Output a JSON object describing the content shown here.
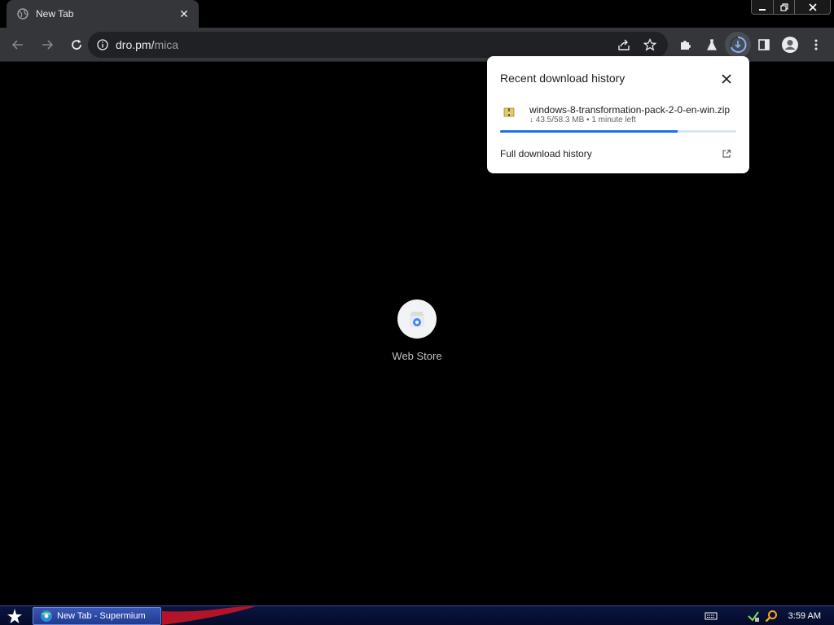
{
  "tab": {
    "title": "New Tab",
    "close_glyph": "✕"
  },
  "window_controls": {
    "minimize": "minimize-icon",
    "restore": "restore-icon",
    "close": "close-icon"
  },
  "toolbar": {
    "back": "arrow-left-icon",
    "forward": "arrow-right-icon",
    "reload": "reload-icon",
    "url_host": "dro.pm/",
    "url_path": "mica",
    "share": "share-icon",
    "bookmark": "star-icon",
    "extensions": "puzzle-icon",
    "labs": "flask-icon",
    "downloads": "download-icon",
    "side_panel": "side-panel-icon",
    "profile": "profile-icon",
    "menu": "kebab-menu-icon"
  },
  "content": {
    "shortcut_label": "Web Store"
  },
  "downloads_bubble": {
    "title": "Recent download history",
    "file_name": "windows-8-transformation-pack-2-0-en-win.zip",
    "status": "↓ 43.5/58.3 MB • 1 minute left",
    "progress_percent": 75,
    "full_history_label": "Full download history"
  },
  "taskbar": {
    "task_label": "New Tab - Supermium",
    "clock": "3:59 AM"
  },
  "colors": {
    "chrome_dark": "#35363a",
    "omnibox": "#202124",
    "accent_blue": "#1a73e8",
    "taskbar": "#0a1640"
  }
}
